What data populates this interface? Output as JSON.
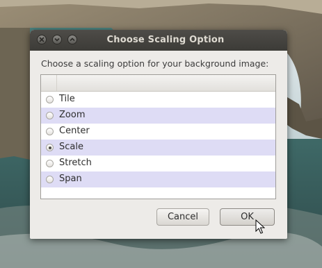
{
  "dialog": {
    "title": "Choose Scaling Option",
    "prompt": "Choose a scaling option for your background image:",
    "window_buttons": [
      "close-icon",
      "minimize-icon",
      "maximize-icon"
    ]
  },
  "options": [
    {
      "label": "Tile",
      "checked": false
    },
    {
      "label": "Zoom",
      "checked": false
    },
    {
      "label": "Center",
      "checked": false
    },
    {
      "label": "Scale",
      "checked": true
    },
    {
      "label": "Stretch",
      "checked": false
    },
    {
      "label": "Span",
      "checked": false
    }
  ],
  "buttons": {
    "cancel_label": "Cancel",
    "ok_label": "OK"
  },
  "colors": {
    "titlebar": "#3c3b37",
    "dialog_bg": "#edebe8",
    "row_alt": "#dedcf5"
  }
}
